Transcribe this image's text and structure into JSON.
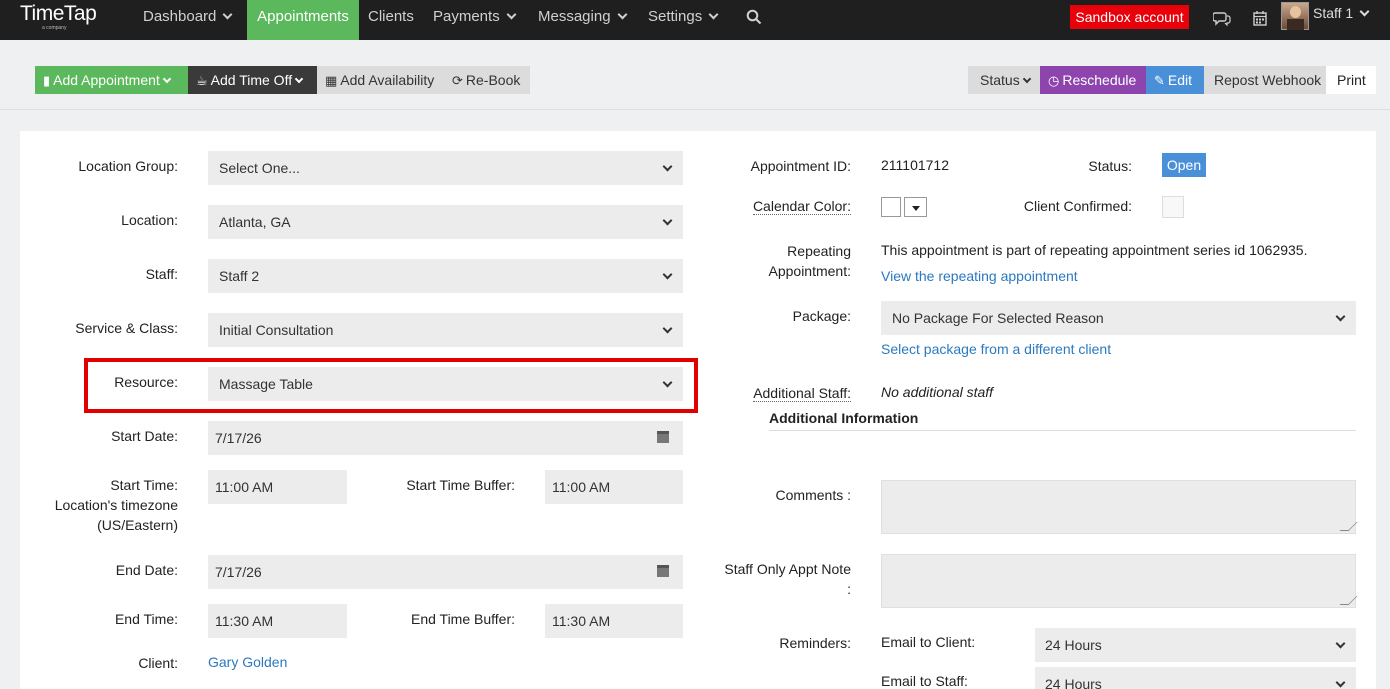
{
  "nav": {
    "logo": "TimeTap",
    "logo_sub": "a company",
    "items": [
      {
        "label": "Dashboard",
        "dropdown": true
      },
      {
        "label": "Appointments",
        "dropdown": false,
        "active": true
      },
      {
        "label": "Clients",
        "dropdown": false
      },
      {
        "label": "Payments",
        "dropdown": true
      },
      {
        "label": "Messaging",
        "dropdown": true
      },
      {
        "label": "Settings",
        "dropdown": true
      }
    ],
    "sandbox": "Sandbox account",
    "user": "Staff 1"
  },
  "toolbar": {
    "add_appointment": "Add Appointment",
    "add_time_off": "Add Time Off",
    "add_availability": "Add Availability",
    "rebook": "Re-Book",
    "status": "Status",
    "reschedule": "Reschedule",
    "edit": "Edit",
    "repost_webhook": "Repost Webhook",
    "print": "Print"
  },
  "form": {
    "location_group": {
      "label": "Location Group:",
      "value": "Select One..."
    },
    "location": {
      "label": "Location:",
      "value": "Atlanta, GA"
    },
    "staff": {
      "label": "Staff:",
      "value": "Staff 2"
    },
    "service": {
      "label": "Service & Class:",
      "value": "Initial Consultation"
    },
    "resource": {
      "label": "Resource:",
      "value": "Massage Table"
    },
    "start_date": {
      "label": "Start Date:",
      "value": "7/17/26"
    },
    "start_time": {
      "label_1": "Start Time:",
      "label_2": "Location's timezone",
      "label_3": "(US/Eastern)",
      "value": "11:00 AM"
    },
    "start_buffer": {
      "label": "Start Time Buffer:",
      "value": "11:00 AM"
    },
    "end_date": {
      "label": "End Date:",
      "value": "7/17/26"
    },
    "end_time": {
      "label": "End Time:",
      "value": "11:30 AM"
    },
    "end_buffer": {
      "label": "End Time Buffer:",
      "value": "11:30 AM"
    },
    "client": {
      "label": "Client:",
      "value": "Gary Golden"
    }
  },
  "details": {
    "appointment_id": {
      "label": "Appointment ID:",
      "value": "211101712"
    },
    "status": {
      "label": "Status:",
      "value": "Open"
    },
    "calendar_color": {
      "label": "Calendar Color:"
    },
    "client_confirmed": {
      "label": "Client Confirmed:"
    },
    "repeating": {
      "label_1": "Repeating",
      "label_2": "Appointment:",
      "text": "This appointment is part of repeating appointment series id 1062935.",
      "link": "View the repeating appointment"
    },
    "package": {
      "label": "Package:",
      "value": "No Package For Selected Reason",
      "link": "Select package from a different client"
    },
    "additional_staff": {
      "label": "Additional Staff:",
      "value": "No additional staff"
    },
    "additional_info_title": "Additional Information",
    "comments": {
      "label": "Comments :"
    },
    "staff_note": {
      "label_1": "Staff Only Appt Note",
      "label_2": ":"
    },
    "reminders": {
      "label": "Reminders:",
      "email_client": {
        "label": "Email to Client:",
        "value": "24 Hours"
      },
      "email_staff": {
        "label": "Email to Staff:",
        "value": "24 Hours"
      }
    }
  },
  "colors": {
    "nav_bg": "#1f1f1f",
    "green": "#5cb85c",
    "purple": "#8e44ad",
    "blue": "#4a90d9",
    "sandbox_red": "#e8000b",
    "link": "#2a79c0",
    "highlight_red": "#e00000"
  }
}
